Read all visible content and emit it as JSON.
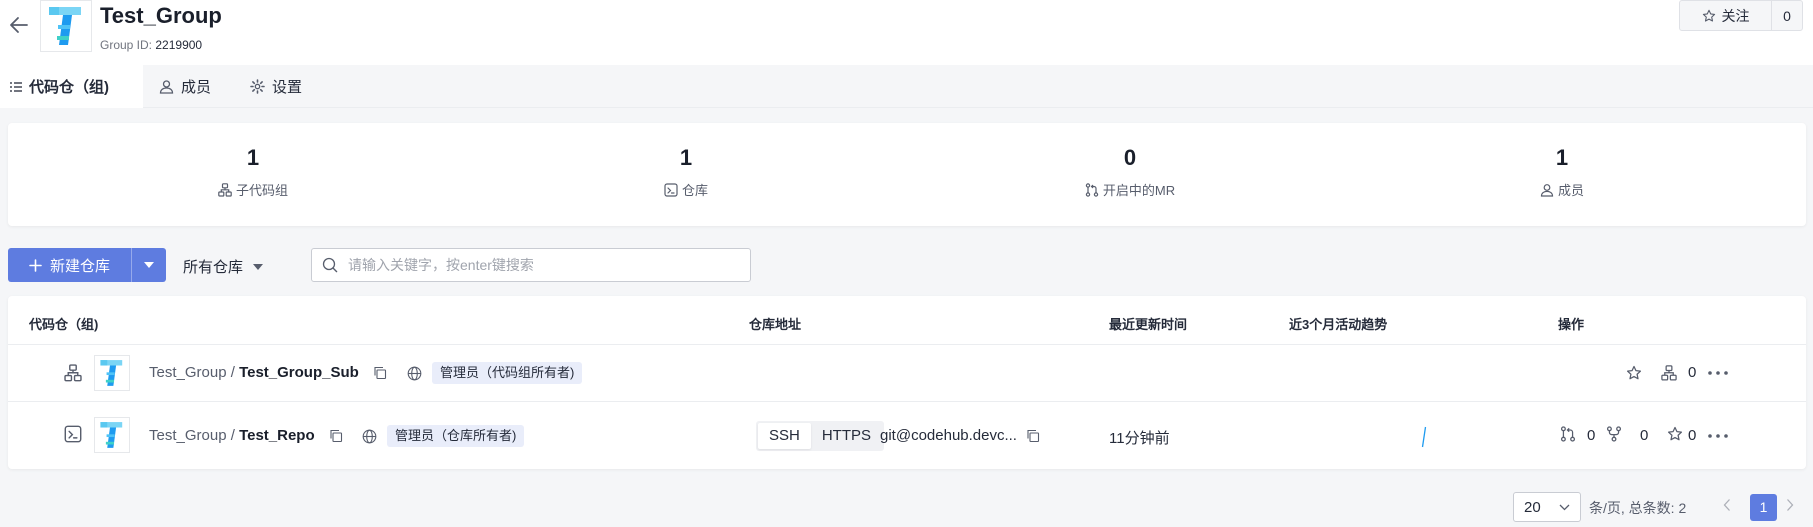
{
  "header": {
    "title": "Test_Group",
    "group_id_label": "Group ID:",
    "group_id": "2219900",
    "follow_label": "关注",
    "follow_count": "0"
  },
  "tabs": [
    {
      "label": "代码仓（组)"
    },
    {
      "label": "成员"
    },
    {
      "label": "设置"
    }
  ],
  "stats": [
    {
      "value": "1",
      "label": "子代码组",
      "icon": "subgroup-icon"
    },
    {
      "value": "1",
      "label": "仓库",
      "icon": "repo-icon"
    },
    {
      "value": "0",
      "label": "开启中的MR",
      "icon": "merge-request-icon"
    },
    {
      "value": "1",
      "label": "成员",
      "icon": "member-icon"
    }
  ],
  "toolbar": {
    "new_repo_label": "新建仓库",
    "filter_label": "所有仓库",
    "search_placeholder": "请输入关键字，按enter键搜索"
  },
  "table": {
    "columns": [
      "代码仓（组)",
      "仓库地址",
      "最近更新时间",
      "近3个月活动趋势",
      "操作"
    ],
    "rows": [
      {
        "type": "group",
        "namespace": "Test_Group",
        "separator": "/",
        "name": "Test_Group_Sub",
        "role": "管理员（代码组所有者)",
        "subgroup_count": "0"
      },
      {
        "type": "repo",
        "namespace": "Test_Group",
        "separator": "/",
        "name": "Test_Repo",
        "role": "管理员（仓库所有者)",
        "protocols": [
          "SSH",
          "HTTPS"
        ],
        "active_protocol": "SSH",
        "address": "git@codehub.devc...",
        "updated": "11分钟前",
        "mr_count": "0",
        "fork_count": "0",
        "star_count": "0"
      }
    ]
  },
  "pagination": {
    "page_size": "20",
    "summary": "条/页, 总条数: 2",
    "current_page": "1"
  },
  "colors": {
    "primary": "#5e7ce0",
    "badge_bg": "#e9edfa",
    "logo_light": "#7bd5f5",
    "logo_dark": "#1e9bf0"
  }
}
